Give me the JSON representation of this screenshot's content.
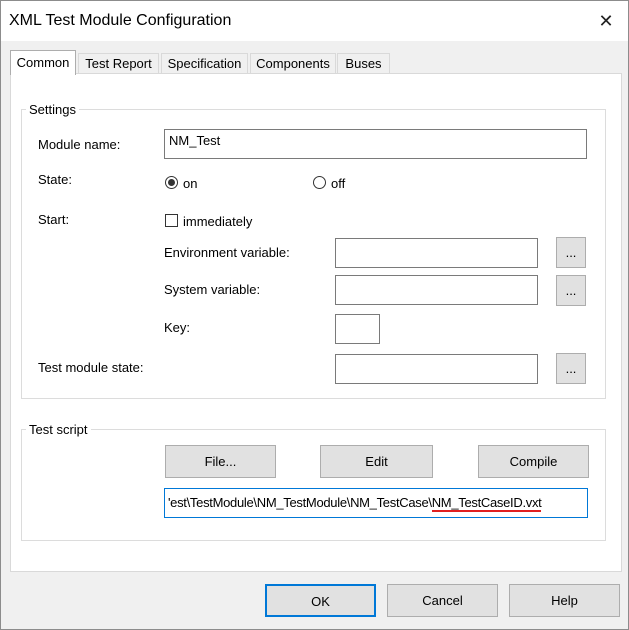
{
  "window": {
    "title": "XML Test Module Configuration"
  },
  "tabs": [
    "Common",
    "Test Report",
    "Specification",
    "Components",
    "Buses"
  ],
  "settings": {
    "group_label": "Settings",
    "module_name_label": "Module name:",
    "module_name_value": "NM_Test",
    "state_label": "State:",
    "state_on": "on",
    "state_off": "off",
    "state_selected": "on",
    "start_label": "Start:",
    "immediately_label": "immediately",
    "immediately_checked": false,
    "env_var_label": "Environment variable:",
    "env_var_value": "",
    "sys_var_label": "System variable:",
    "sys_var_value": "",
    "key_label": "Key:",
    "key_value": "",
    "test_module_state_label": "Test module state:",
    "test_module_state_value": "",
    "browse_label": "..."
  },
  "test_script": {
    "group_label": "Test script",
    "file_button": "File...",
    "edit_button": "Edit",
    "compile_button": "Compile",
    "path_value": "'est\\TestModule\\NM_TestModule\\NM_TestCase\\NM_TestCaseID.vxt",
    "path_prefix": "'est\\TestModule\\NM_TestModule\\NM_TestCase\\",
    "path_highlight": "NM_TestCaseID.vxt",
    "highlight_color": "#e02020"
  },
  "footer": {
    "ok": "OK",
    "cancel": "Cancel",
    "help": "Help"
  }
}
